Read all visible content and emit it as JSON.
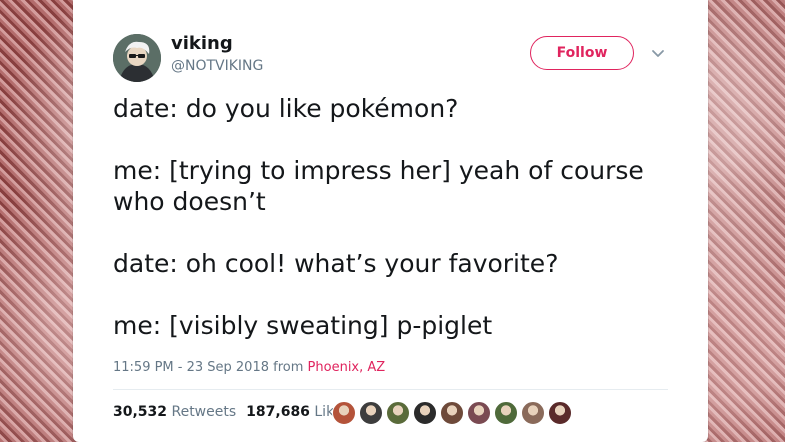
{
  "author": {
    "name": "viking",
    "handle": "@NOTVIKING"
  },
  "follow_button": {
    "label": "Follow"
  },
  "tweet": {
    "paragraphs": [
      "date: do you like pokémon?",
      "me: [trying to impress her] yeah of course who doesn’t",
      "date: oh cool! what’s your favorite?",
      "me: [visibly sweating] p-piglet"
    ],
    "timestamp": "11:59 PM - 23 Sep 2018",
    "from_label": "from",
    "location": "Phoenix, AZ"
  },
  "stats": {
    "retweets_count": "30,532",
    "retweets_label": "Retweets",
    "likes_count": "187,686",
    "likes_label": "Likes"
  },
  "colors": {
    "accent": "#e0245e",
    "text": "#14171a",
    "muted": "#657786"
  },
  "icons": {
    "more": "chevron-down-icon"
  },
  "liker_avatars": [
    "#b4533a",
    "#3d3d3d",
    "#5a6b3a",
    "#2b2b2b",
    "#6e4a3a",
    "#7a4a52",
    "#4f6a3a",
    "#8a6a5a",
    "#5a2a2a"
  ]
}
